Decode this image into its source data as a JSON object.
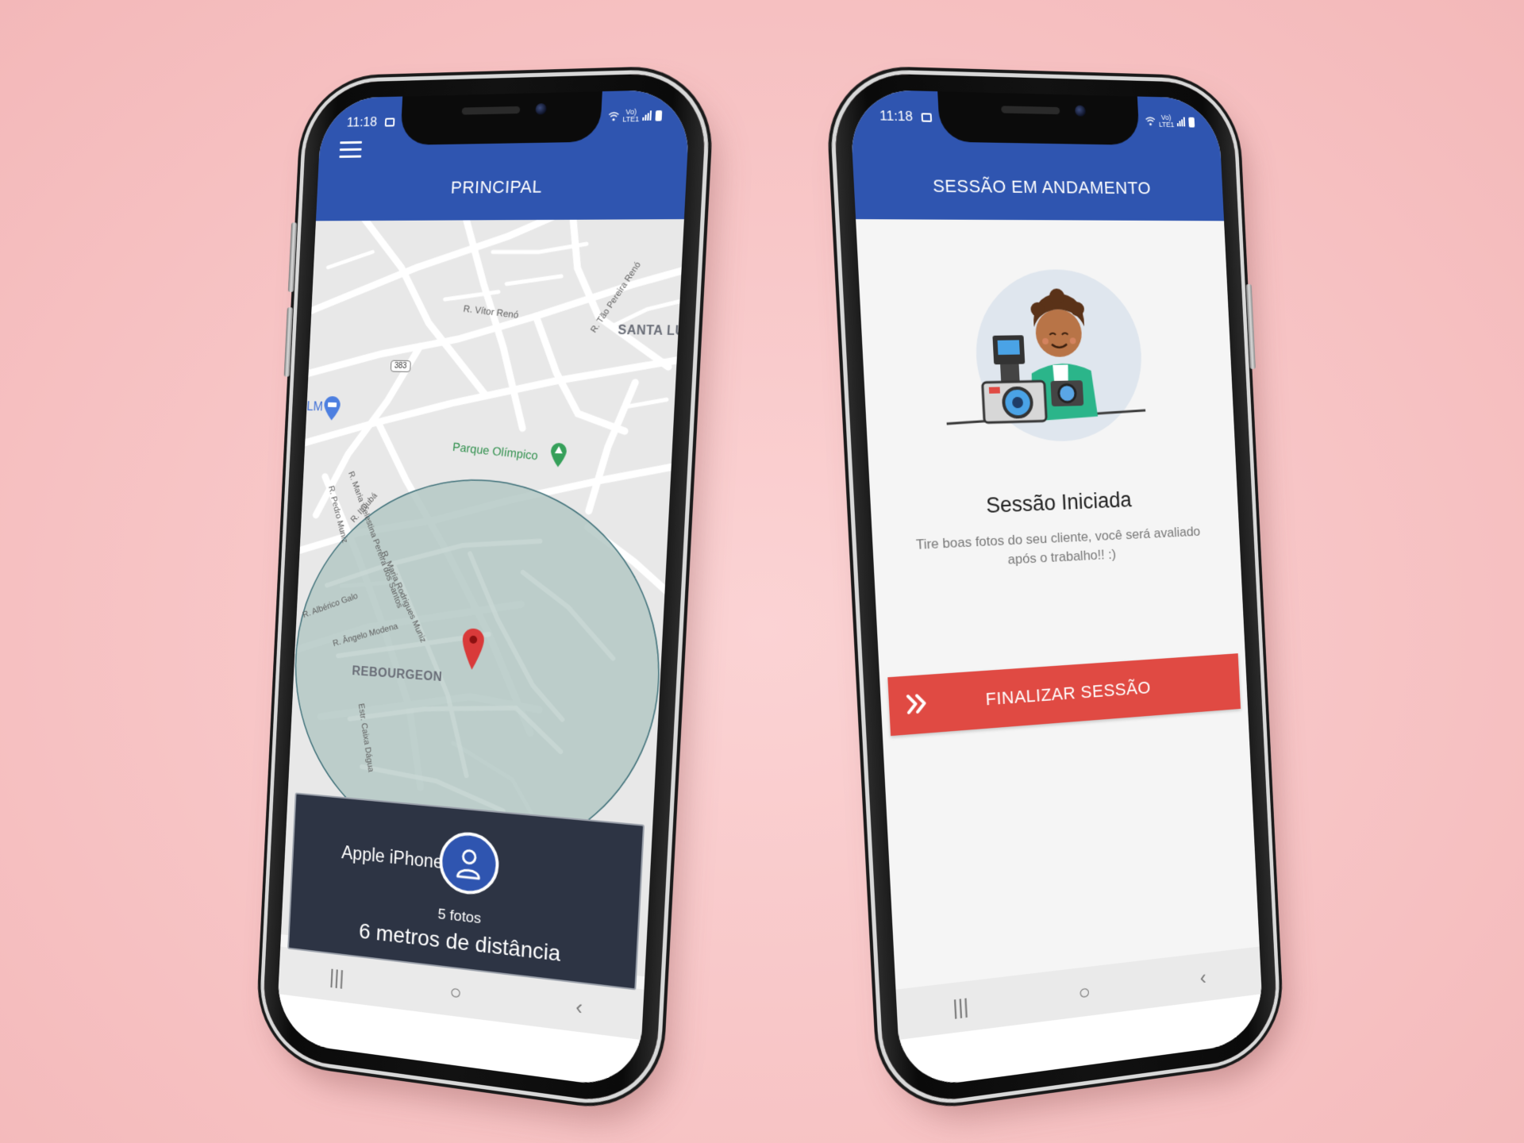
{
  "status": {
    "time": "11:18",
    "net_top": "Vo)",
    "net_bottom": "LTE1"
  },
  "left_screen": {
    "title": "PRINCIPAL",
    "map_labels": {
      "street_vitor_reno": "R. Vítor Renó",
      "street_tao_pereira": "R. Tão Pereira Renó",
      "neighborhood_santa": "SANTA LU",
      "route": "383",
      "poi_partial": "LM",
      "park": "Parque Olímpico",
      "street_maria_celestina": "R. Maria Celestina Pereira dos Santos",
      "street_itajuba": "R. Itajubá",
      "street_pedro_muniz": "R. Pedro Muniz",
      "street_maria_rodrigues": "R. Maria Rodrigues Muniz",
      "street_alberico": "R. Albérico Galo",
      "street_angelo": "R. Ângelo Modena",
      "neighborhood": "REBOURGEON",
      "street_caixa": "Estr. Caixa Dágua"
    },
    "card": {
      "device": "Apple iPhone",
      "photos": "5 fotos",
      "distance": "6 metros de distância"
    }
  },
  "right_screen": {
    "title": "SESSÃO EM ANDAMENTO",
    "heading": "Sessão Iniciada",
    "subtitle": "Tire boas fotos do seu cliente, você será avaliado após o trabalho!! :)",
    "button": "FINALIZAR SESSÃO"
  },
  "nav": {
    "recents": "|||",
    "home": "○",
    "back": "‹"
  },
  "colors": {
    "appbar": "#2f55b0",
    "accent_red": "#e04a43",
    "card_bg": "#2d3444",
    "radius_fill": "#b4c8c4",
    "pin": "#d93a3a"
  },
  "icons": {
    "menu": "hamburger-menu-icon",
    "pin": "map-pin-icon",
    "person": "person-icon",
    "chevrons": "double-chevron-right-icon",
    "cart": "shopping-cart-icon",
    "tree": "tree-icon"
  }
}
